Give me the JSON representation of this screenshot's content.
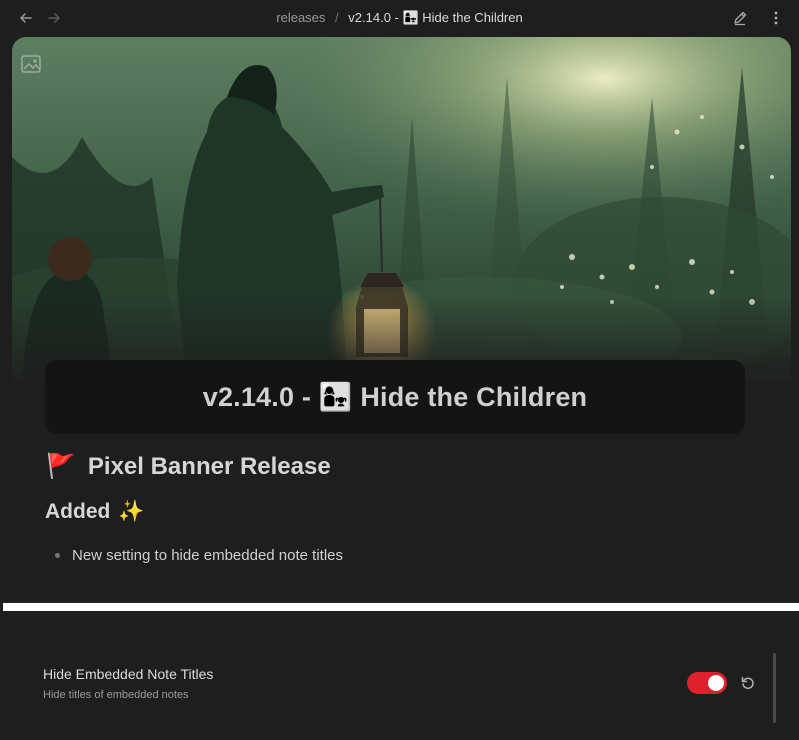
{
  "topbar": {
    "breadcrumb_folder": "releases",
    "breadcrumb_separator": "/",
    "breadcrumb_current": "v2.14.0 - 👩‍👧 Hide the Children"
  },
  "banner": {
    "image": "forest-lantern-scene",
    "icon": "image-icon"
  },
  "note": {
    "title": "v2.14.0 - 👩‍👧 Hide the Children",
    "heading1_icon": "🚩",
    "heading1": "Pixel Banner Release",
    "heading2": "Added",
    "heading2_icon": "✨",
    "bullets": [
      "New setting to hide embedded note titles"
    ]
  },
  "settings": {
    "name": "Hide Embedded Note Titles",
    "description": "Hide titles of embedded notes",
    "toggle_on": true,
    "accent_color": "#e0202c"
  }
}
